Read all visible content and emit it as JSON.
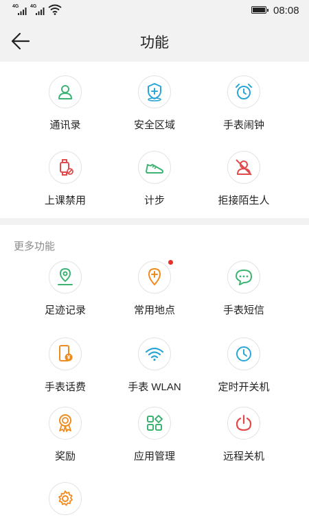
{
  "status_bar": {
    "network_1": "4G",
    "network_2": "4G",
    "time": "08:08"
  },
  "header": {
    "title": "功能"
  },
  "functions": [
    {
      "label": "通讯录",
      "icon": "contacts-icon",
      "color": "#3cb371"
    },
    {
      "label": "安全区域",
      "icon": "shield-plus-icon",
      "color": "#2aa6d6"
    },
    {
      "label": "手表闹钟",
      "icon": "alarm-clock-icon",
      "color": "#2aa6d6"
    },
    {
      "label": "上课禁用",
      "icon": "watch-forbidden-icon",
      "color": "#e04a4a"
    },
    {
      "label": "计步",
      "icon": "shoe-icon",
      "color": "#3cb371"
    },
    {
      "label": "拒接陌生人",
      "icon": "block-person-icon",
      "color": "#e04a4a"
    }
  ],
  "more": {
    "title": "更多功能",
    "items": [
      {
        "label": "足迹记录",
        "icon": "footprint-pin-icon",
        "color": "#3cb371"
      },
      {
        "label": "常用地点",
        "icon": "location-plus-icon",
        "color": "#f08a1c",
        "badge": true
      },
      {
        "label": "手表短信",
        "icon": "chat-bubble-icon",
        "color": "#3cb371"
      },
      {
        "label": "手表话费",
        "icon": "phone-fee-icon",
        "color": "#f08a1c"
      },
      {
        "label": "手表 WLAN",
        "icon": "wifi-icon",
        "color": "#2aa6d6"
      },
      {
        "label": "定时开关机",
        "icon": "clock-icon",
        "color": "#2aa6d6"
      },
      {
        "label": "奖励",
        "icon": "award-medal-icon",
        "color": "#f08a1c"
      },
      {
        "label": "应用管理",
        "icon": "app-grid-icon",
        "color": "#3cb371"
      },
      {
        "label": "远程关机",
        "icon": "power-icon",
        "color": "#e04a4a"
      },
      {
        "label": "",
        "icon": "settings-gear-icon",
        "color": "#f08a1c"
      }
    ]
  }
}
